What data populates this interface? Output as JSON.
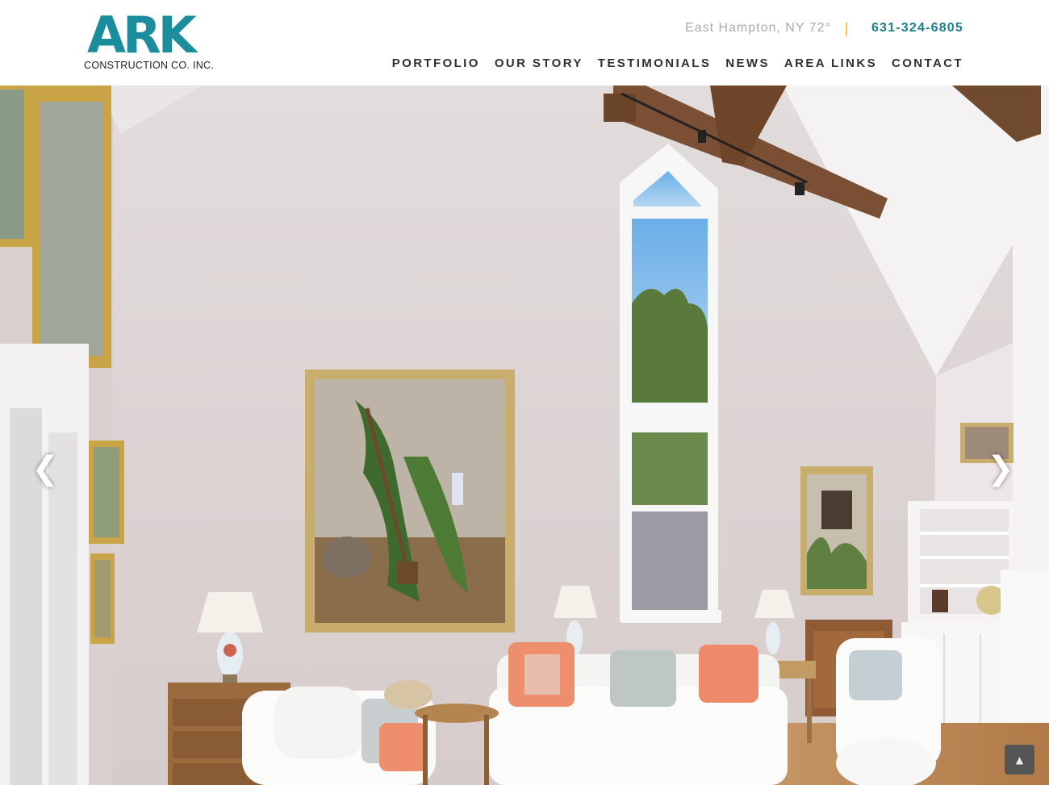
{
  "brand": {
    "logo_text": "ARK",
    "logo_subtitle": "CONSTRUCTION CO. INC.",
    "color": "#1b8d9c"
  },
  "topbar": {
    "weather": "East Hampton, NY 72°",
    "separator": "|",
    "phone": "631-324-6805"
  },
  "nav": {
    "items": [
      "PORTFOLIO",
      "OUR STORY",
      "TESTIMONIALS",
      "NEWS",
      "AREA LINKS",
      "CONTACT"
    ]
  },
  "slider": {
    "prev_icon": "chevron-left-icon",
    "next_icon": "chevron-right-icon",
    "prev_glyph": "❮",
    "next_glyph": "❯",
    "scene": "living-room-photo"
  },
  "scroll_top": {
    "icon": "chevron-up-icon",
    "glyph": "▲"
  }
}
